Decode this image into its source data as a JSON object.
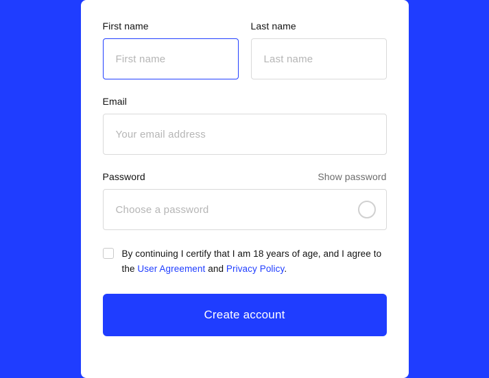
{
  "colors": {
    "accent": "#1f3dff"
  },
  "form": {
    "first_name": {
      "label": "First name",
      "placeholder": "First name",
      "value": ""
    },
    "last_name": {
      "label": "Last name",
      "placeholder": "Last name",
      "value": ""
    },
    "email": {
      "label": "Email",
      "placeholder": "Your email address",
      "value": ""
    },
    "password": {
      "label": "Password",
      "placeholder": "Choose a password",
      "value": "",
      "show_password_label": "Show password"
    },
    "consent": {
      "checked": false,
      "prefix": "By continuing I certify that I am 18 years of age, and I agree to the ",
      "user_agreement": "User Agreement",
      "and": " and ",
      "privacy_policy": "Privacy Policy",
      "suffix": "."
    },
    "submit_label": "Create account"
  }
}
